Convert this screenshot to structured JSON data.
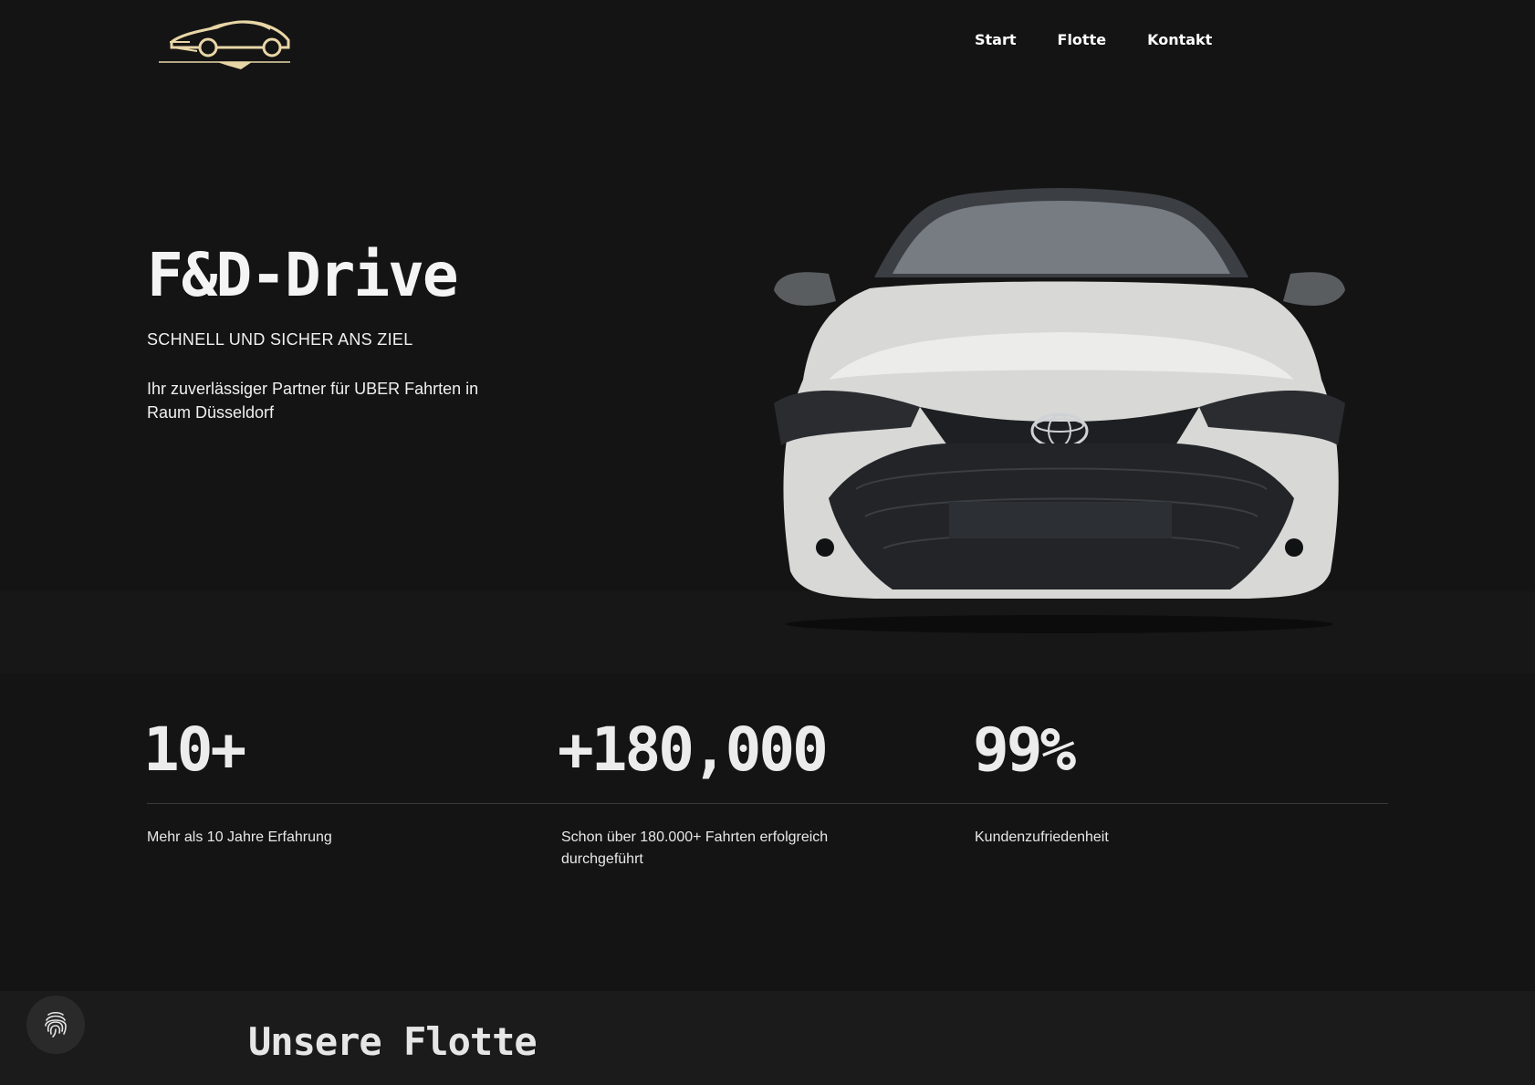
{
  "header": {
    "logo_icon": "sports-car-logo",
    "nav": [
      {
        "label": "Start"
      },
      {
        "label": "Flotte"
      },
      {
        "label": "Kontakt"
      }
    ]
  },
  "hero": {
    "title": "F&D-Drive",
    "tagline": "SCHNELL UND SICHER ANS ZIEL",
    "description": "Ihr zuverlässiger Partner für UBER Fahrten in Raum Düsseldorf",
    "image_icon": "white-toyota-front-view"
  },
  "stats": [
    {
      "value": "10+",
      "label": "Mehr als 10 Jahre Erfahrung"
    },
    {
      "value": "+180,000",
      "label": "Schon über 180.000+ Fahrten erfolgreich durchgeführt"
    },
    {
      "value": "99%",
      "label": "Kundenzufriedenheit"
    }
  ],
  "fleet": {
    "title": "Unsere Flotte"
  },
  "cookie_button": {
    "icon": "fingerprint-icon"
  },
  "colors": {
    "background": "#141414",
    "logo_gold": "#e8d6a6",
    "text": "#f2f2f2"
  }
}
